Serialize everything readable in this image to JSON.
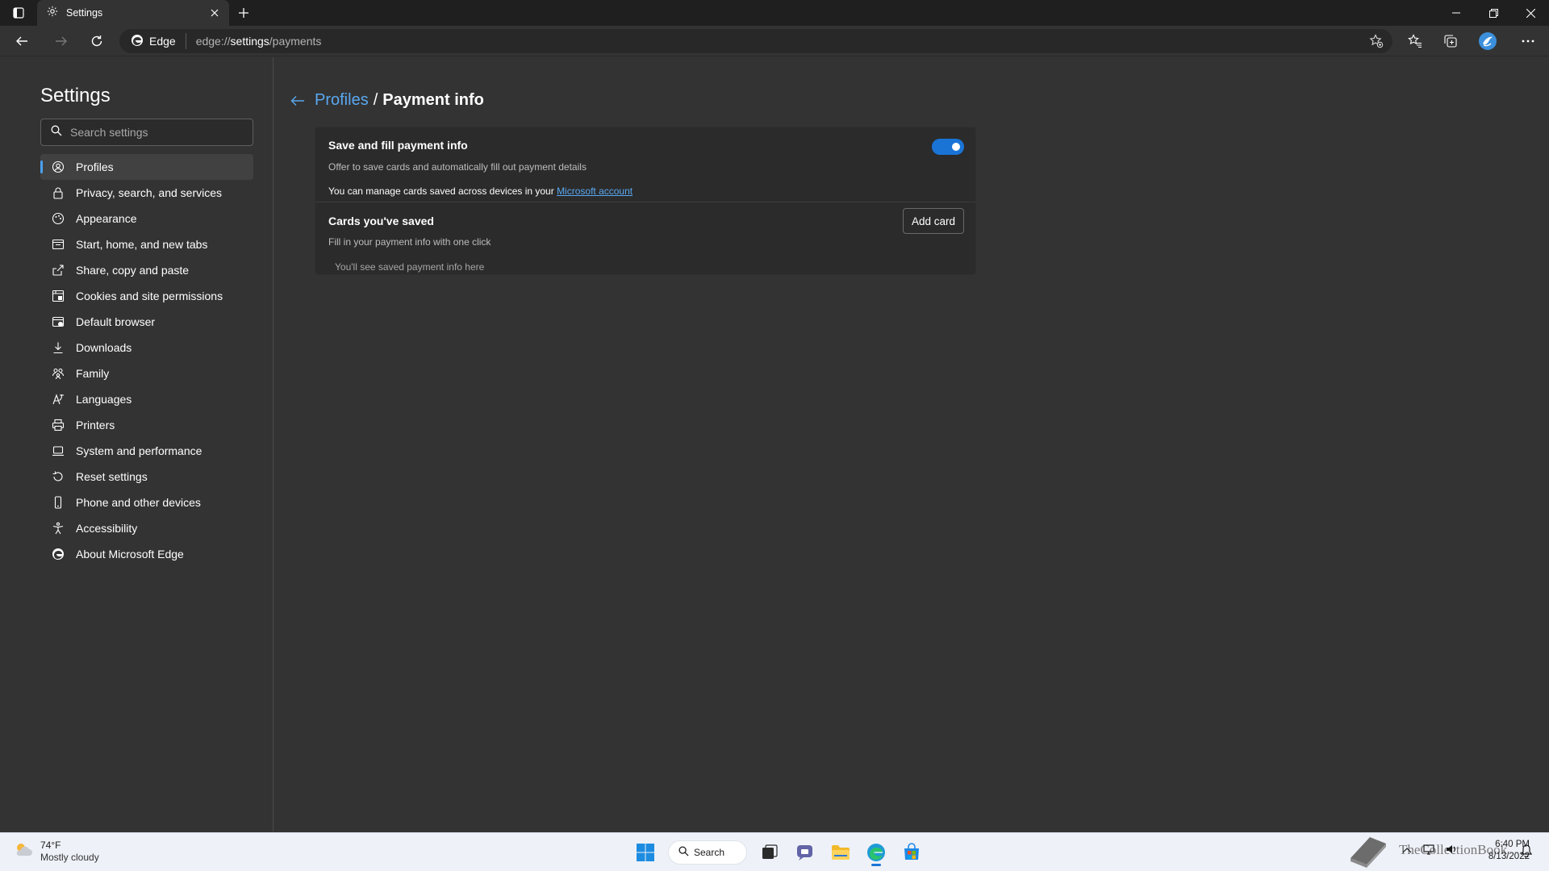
{
  "browser": {
    "tab": {
      "title": "Settings"
    },
    "address": {
      "site": "Edge",
      "url_prefix": "edge://",
      "url_main": "settings",
      "url_suffix": "/payments"
    }
  },
  "settings": {
    "title": "Settings",
    "search_placeholder": "Search settings",
    "nav": [
      {
        "label": "Profiles",
        "icon": "profile-icon",
        "active": true
      },
      {
        "label": "Privacy, search, and services",
        "icon": "lock-icon"
      },
      {
        "label": "Appearance",
        "icon": "appearance-icon"
      },
      {
        "label": "Start, home, and new tabs",
        "icon": "home-tabs-icon"
      },
      {
        "label": "Share, copy and paste",
        "icon": "share-icon"
      },
      {
        "label": "Cookies and site permissions",
        "icon": "cookies-icon"
      },
      {
        "label": "Default browser",
        "icon": "browser-icon"
      },
      {
        "label": "Downloads",
        "icon": "download-icon"
      },
      {
        "label": "Family",
        "icon": "family-icon"
      },
      {
        "label": "Languages",
        "icon": "languages-icon"
      },
      {
        "label": "Printers",
        "icon": "printer-icon"
      },
      {
        "label": "System and performance",
        "icon": "laptop-icon"
      },
      {
        "label": "Reset settings",
        "icon": "reset-icon"
      },
      {
        "label": "Phone and other devices",
        "icon": "phone-icon"
      },
      {
        "label": "Accessibility",
        "icon": "accessibility-icon"
      },
      {
        "label": "About Microsoft Edge",
        "icon": "edge-icon"
      }
    ]
  },
  "page": {
    "breadcrumb_parent": "Profiles",
    "breadcrumb_sep": "/",
    "breadcrumb_current": "Payment info",
    "save_fill": {
      "title": "Save and fill payment info",
      "desc": "Offer to save cards and automatically fill out payment details",
      "manage_prefix": "You can manage cards saved across devices in your",
      "manage_link": "Microsoft account",
      "enabled": true
    },
    "cards": {
      "title": "Cards you've saved",
      "desc": "Fill in your payment info with one click",
      "add_button": "Add card",
      "empty": "You'll see saved payment info here"
    }
  },
  "taskbar": {
    "weather_temp": "74°F",
    "weather_cond": "Mostly cloudy",
    "search_label": "Search",
    "watermark": "TheCollectionBook",
    "time": "6:40 PM",
    "date": "8/13/2022"
  },
  "colors": {
    "accent": "#1a74d6",
    "link": "#5aa8f0",
    "bg": "#333333",
    "card": "#2b2b2b"
  }
}
